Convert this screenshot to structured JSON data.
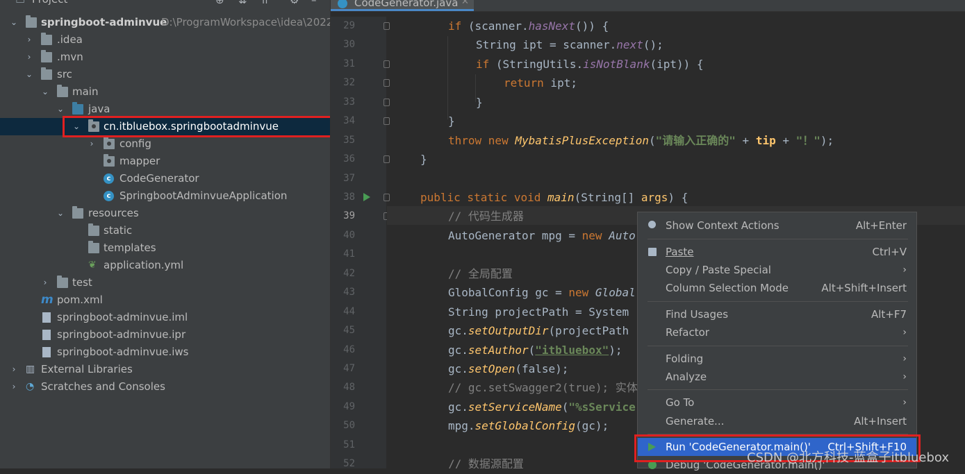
{
  "project_panel": {
    "title": "Project",
    "tree": [
      {
        "label": "springboot-adminvue",
        "path": "D:\\ProgramWorkspace\\idea\\2022"
      },
      {
        "label": ".idea"
      },
      {
        "label": ".mvn"
      },
      {
        "label": "src"
      },
      {
        "label": "main"
      },
      {
        "label": "java"
      },
      {
        "label": "cn.itbluebox.springbootadminvue"
      },
      {
        "label": "config"
      },
      {
        "label": "mapper"
      },
      {
        "label": "CodeGenerator"
      },
      {
        "label": "SpringbootAdminvueApplication"
      },
      {
        "label": "resources"
      },
      {
        "label": "static"
      },
      {
        "label": "templates"
      },
      {
        "label": "application.yml"
      },
      {
        "label": "test"
      },
      {
        "label": "pom.xml"
      },
      {
        "label": "springboot-adminvue.iml"
      },
      {
        "label": "springboot-adminvue.ipr"
      },
      {
        "label": "springboot-adminvue.iws"
      },
      {
        "label": "External Libraries"
      },
      {
        "label": "Scratches and Consoles"
      }
    ]
  },
  "editor": {
    "tab_label": "CodeGenerator.java",
    "line_numbers": [
      "29",
      "30",
      "31",
      "32",
      "33",
      "34",
      "35",
      "36",
      "37",
      "38",
      "39",
      "40",
      "41",
      "42",
      "43",
      "44",
      "45",
      "46",
      "47",
      "48",
      "49",
      "50",
      "51",
      "52"
    ],
    "current_line": "39",
    "code": {
      "l29": {
        "a": "if",
        "b": " (scanner.",
        "c": "hasNext",
        "d": "()) {"
      },
      "l30": {
        "a": "String ipt = scanner.",
        "b": "next",
        "c": "();"
      },
      "l31": {
        "a": "if",
        "b": " (StringUtils.",
        "c": "isNotBlank",
        "d": "(ipt)) {"
      },
      "l32": {
        "a": "return",
        "b": " ipt;"
      },
      "l33": "}",
      "l34": "}",
      "l35": {
        "a": "throw new ",
        "b": "MybatisPlusException",
        "c": "(",
        "d": "\"请输入正确的\"",
        "e": " + ",
        "f": "tip",
        "g": " + ",
        "h": "\"！\"",
        "i": ");"
      },
      "l36": "}",
      "l38": {
        "a": "public static void ",
        "b": "main",
        "c": "(String[] ",
        "d": "args",
        "e": ") {"
      },
      "l39": "// 代码生成器",
      "l40": {
        "a": "AutoGenerator mpg = ",
        "b": "new ",
        "c": "Auto"
      },
      "l42": "// 全局配置",
      "l43": {
        "a": "GlobalConfig gc = ",
        "b": "new ",
        "c": "Global"
      },
      "l44": "String projectPath = System",
      "l45": {
        "a": "gc.",
        "b": "setOutputDir",
        "c": "(projectPath"
      },
      "l46": {
        "a": "gc.",
        "b": "setAuthor",
        "c": "(",
        "d": "\"itbluebox\"",
        "e": ");"
      },
      "l47": {
        "a": "gc.",
        "b": "setOpen",
        "c": "(false);"
      },
      "l48": "// gc.setSwagger2(true); 实体",
      "l49": {
        "a": "gc.",
        "b": "setServiceName",
        "c": "(",
        "d": "\"%sService"
      },
      "l50": {
        "a": "mpg.",
        "b": "setGlobalConfig",
        "c": "(gc);"
      },
      "l52": "// 数据源配置"
    }
  },
  "context_menu": {
    "items": [
      {
        "label": "Show Context Actions",
        "shortcut": "Alt+Enter",
        "icon": "bulb-icon"
      },
      {
        "label": "Paste",
        "shortcut": "Ctrl+V",
        "icon": "clipboard-icon"
      },
      {
        "label": "Copy / Paste Special",
        "submenu": "›"
      },
      {
        "label": "Column Selection Mode",
        "shortcut": "Alt+Shift+Insert"
      },
      {
        "label": "Find Usages",
        "shortcut": "Alt+F7"
      },
      {
        "label": "Refactor",
        "submenu": "›"
      },
      {
        "label": "Folding",
        "submenu": "›"
      },
      {
        "label": "Analyze",
        "submenu": "›"
      },
      {
        "label": "Go To",
        "submenu": "›"
      },
      {
        "label": "Generate...",
        "shortcut": "Alt+Insert"
      },
      {
        "label": "Run 'CodeGenerator.main()'",
        "shortcut": "Ctrl+Shift+F10",
        "icon": "run-icon"
      },
      {
        "label": "Debug 'CodeGenerator.main()'",
        "icon": "debug-icon"
      }
    ]
  },
  "watermark": "CSDN @北方科技-蓝盒子itbluebox",
  "colors": {
    "selection_highlight": "#e02020",
    "menu_active": "#2f65ca",
    "run_green": "#499c54"
  }
}
